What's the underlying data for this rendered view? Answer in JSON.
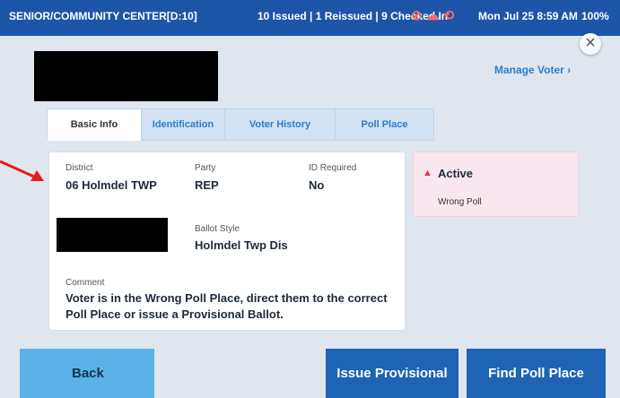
{
  "status_bar": {
    "location": "SENIOR/COMMUNITY CENTER[D:10]",
    "counts": "10 Issued | 1 Reissued | 9 Checked In",
    "datetime": "Mon Jul 25  8:59 AM",
    "battery": "100%"
  },
  "header": {
    "manage_link": "Manage Voter ›"
  },
  "tabs": [
    {
      "label": "Basic Info",
      "active": true
    },
    {
      "label": "Identification",
      "active": false
    },
    {
      "label": "Voter History",
      "active": false
    },
    {
      "label": "Poll Place",
      "active": false
    }
  ],
  "basic_info": {
    "district_label": "District",
    "district_value": "06 Holmdel TWP",
    "party_label": "Party",
    "party_value": "REP",
    "id_label": "ID Required",
    "id_value": "No",
    "ballot_label": "Ballot Style",
    "ballot_value": "Holmdel Twp Dis",
    "comment_label": "Comment",
    "comment_value": "Voter is in the Wrong Poll Place, direct them to the correct Poll Place or issue a Provisional Ballot."
  },
  "status_card": {
    "title": "Active",
    "reason": "Wrong Poll"
  },
  "buttons": {
    "back": "Back",
    "issue_provisional": "Issue Provisional",
    "find_poll_place": "Find Poll Place"
  },
  "colors": {
    "status_bar": "#1d56a8",
    "primary_button": "#1e63b4",
    "back_button": "#5ab2e6",
    "status_card_bg": "#f8e7ee",
    "warning": "#d43b4e"
  },
  "icons": [
    "blocked-icon",
    "cloud-icon",
    "signal-icon",
    "close-icon",
    "warning-icon",
    "arrow-pointer-icon"
  ]
}
